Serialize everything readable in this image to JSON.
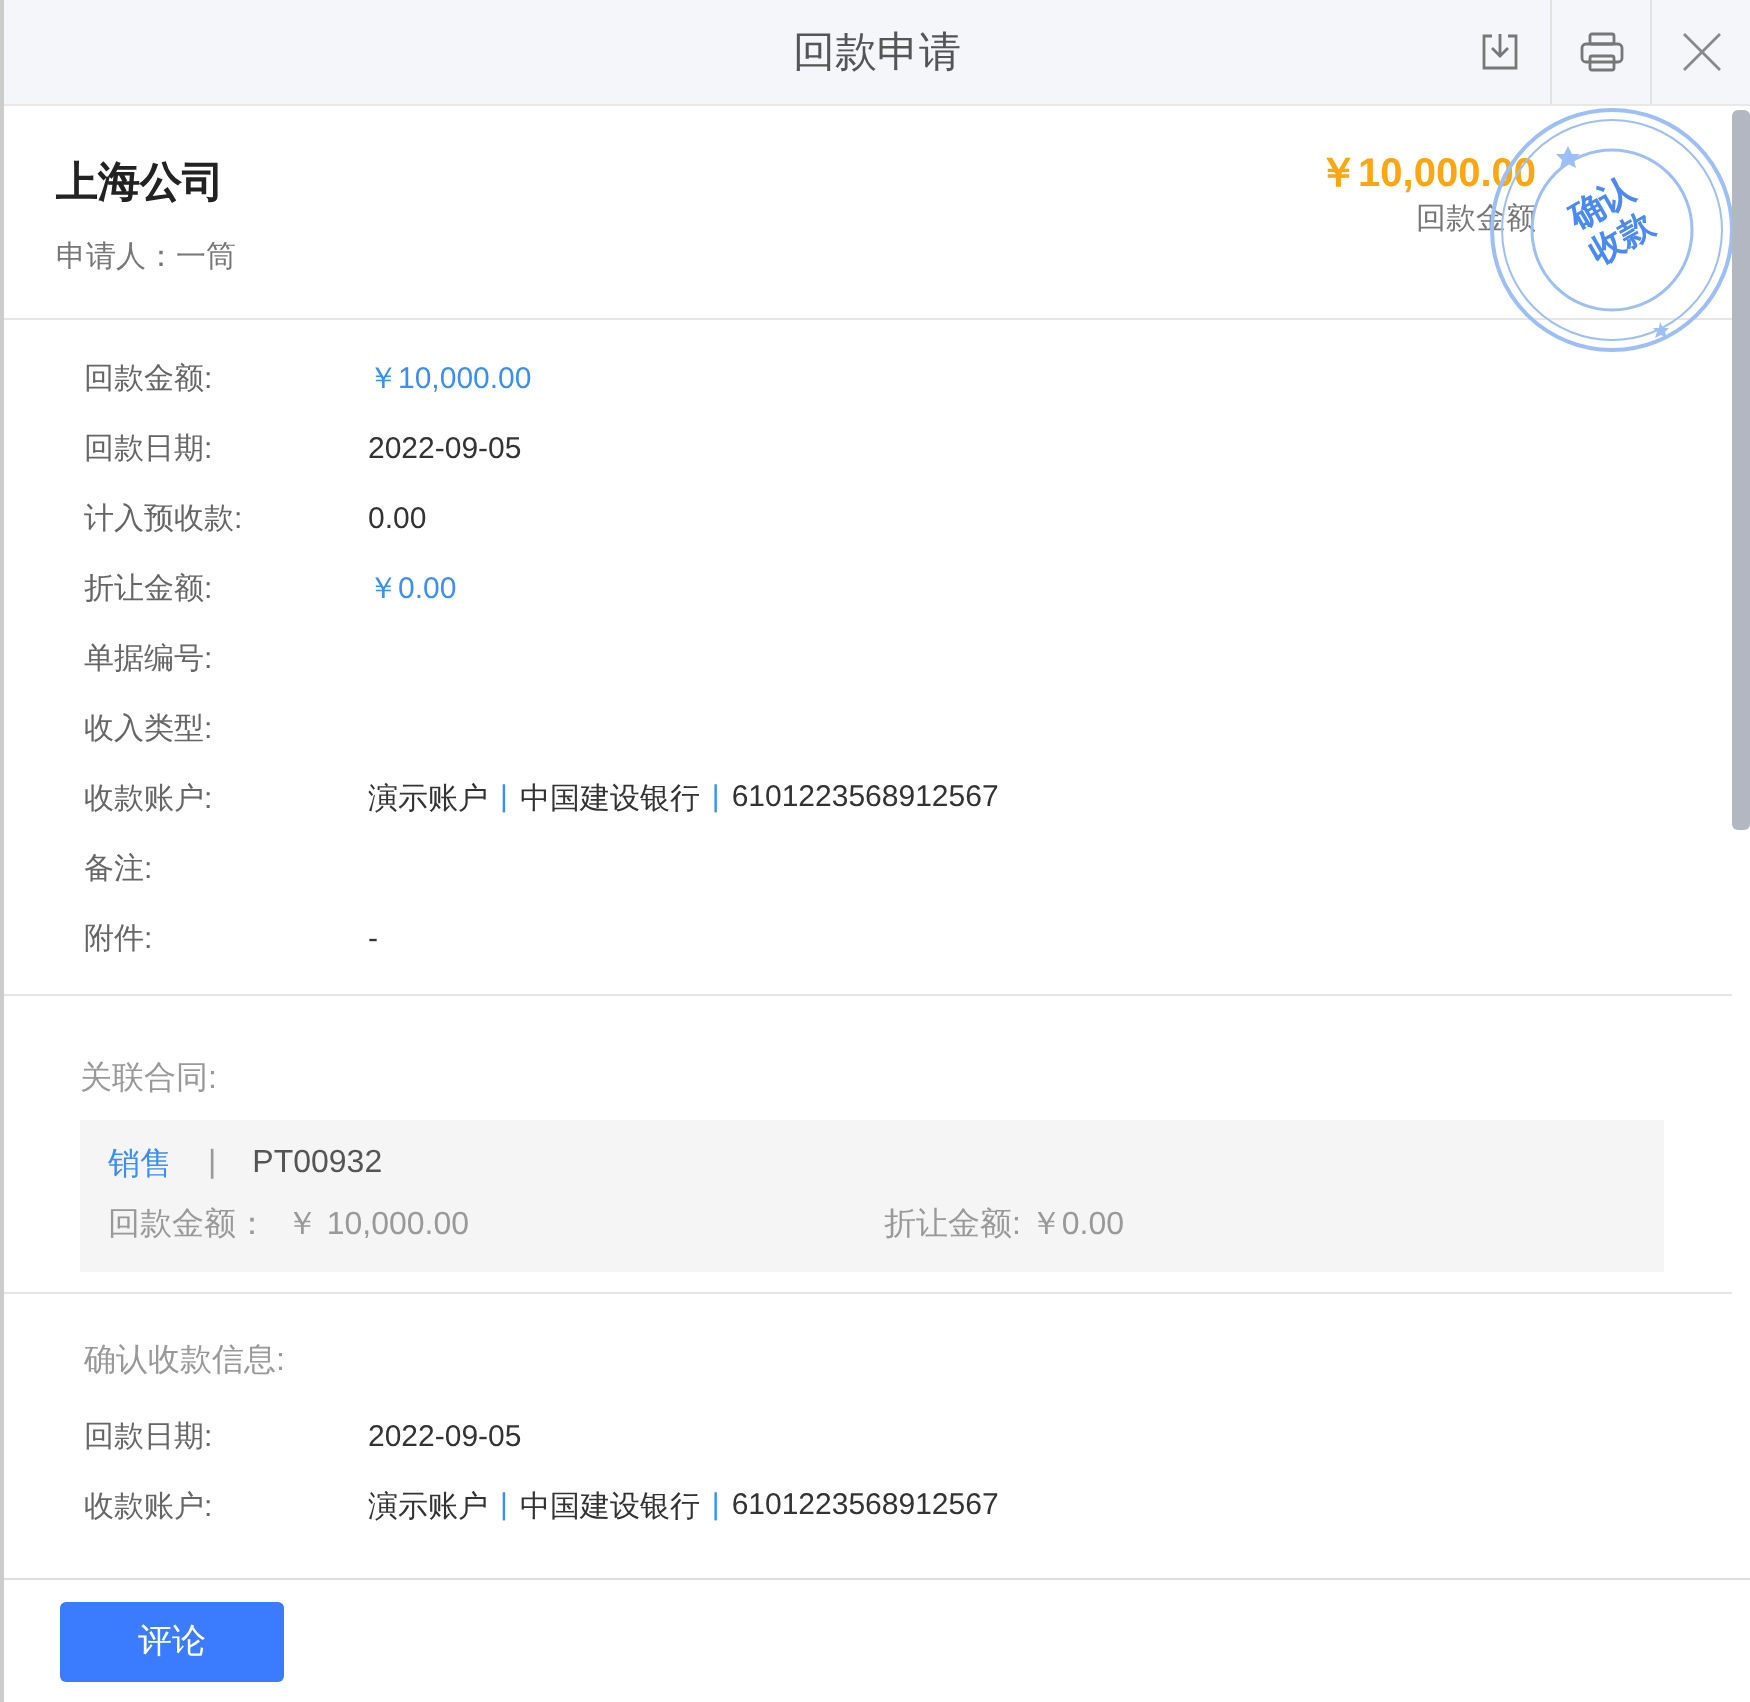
{
  "window": {
    "title": "回款申请"
  },
  "header": {
    "company": "上海公司",
    "applicant": "申请人：一筒",
    "amount": "￥10,000.00",
    "amount_label": "回款金额",
    "stamp": [
      "确认",
      "收款"
    ]
  },
  "details": [
    {
      "label": "回款金额:",
      "kind": "amount",
      "value": "￥10,000.00"
    },
    {
      "label": "回款日期:",
      "kind": "text",
      "value": "2022-09-05"
    },
    {
      "label": "计入预收款:",
      "kind": "text",
      "value": "0.00"
    },
    {
      "label": "折让金额:",
      "kind": "amount",
      "value": "￥0.00"
    },
    {
      "label": "单据编号:",
      "kind": "text"
    },
    {
      "label": "收入类型:",
      "kind": "text"
    },
    {
      "label": "收款账户:",
      "kind": "account",
      "parts": [
        "演示账户",
        "中国建设银行",
        "6101223568912567"
      ],
      "separator": "|"
    },
    {
      "label": "备注:",
      "kind": "text"
    },
    {
      "label": "附件:",
      "kind": "text",
      "value": "-"
    }
  ],
  "contracts": {
    "title": "关联合同:",
    "items": [
      {
        "type": "销售",
        "divider": "|",
        "code": "PT00932",
        "amount_label": "回款金额：",
        "amount": "￥ 10,000.00",
        "discount_label": "折让金额:",
        "discount": "￥0.00"
      }
    ]
  },
  "confirmation": {
    "title": "确认收款信息:",
    "rows": [
      {
        "label": "回款日期:",
        "kind": "text",
        "value": "2022-09-05"
      },
      {
        "label": "收款账户:",
        "kind": "account",
        "parts": [
          "演示账户",
          "中国建设银行",
          "6101223568912567"
        ],
        "separator": "|"
      }
    ]
  },
  "footer": {
    "button": "评论"
  }
}
